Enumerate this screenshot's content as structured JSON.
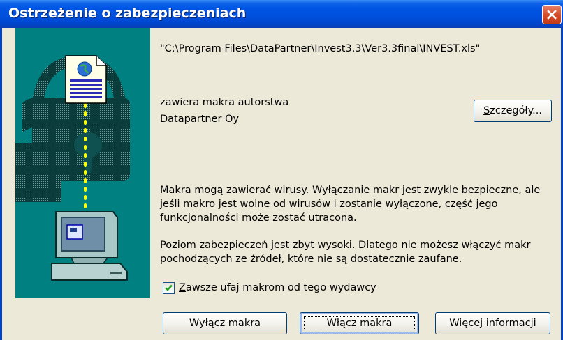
{
  "window": {
    "title": "Ostrzeżenie o zabezpieczeniach"
  },
  "file_path": "\"C:\\Program Files\\DataPartner\\Invest3.3\\Ver3.3final\\INVEST.xls\"",
  "macro_author": {
    "label": "zawiera makra autorstwa",
    "name": "Datapartner Oy"
  },
  "details_button": {
    "hotkey": "S",
    "rest": "zczegóły..."
  },
  "warning_text": "Makra mogą zawierać wirusy. Wyłączanie makr jest zwykle bezpieczne, ale jeśli makro jest wolne od wirusów i zostanie wyłączone, część jego funkcjonalności może zostać utracona.",
  "security_text": "Poziom zabezpieczeń jest zbyt wysoki.  Dlatego nie możesz włączyć makr pochodzących ze źródeł, które nie są dostatecznie zaufane.",
  "trust_checkbox": {
    "checked": true,
    "hotkey": "Z",
    "rest": "awsze ufaj makrom od tego wydawcy"
  },
  "buttons": {
    "disable": {
      "pre": "W",
      "hotkey": "y",
      "post": "łącz makra"
    },
    "enable": {
      "pre": "Włącz ",
      "hotkey": "m",
      "post": "akra"
    },
    "more_info": {
      "pre": "Więcej ",
      "hotkey": "i",
      "post": "nformacji"
    }
  },
  "colors": {
    "titlebar": "#0054E3",
    "panel": "#008080",
    "close_button": "#D34A26",
    "dialog_bg": "#ECE9D8"
  },
  "icons": {
    "close": "close-icon",
    "document": "document-icon",
    "padlock": "padlock-icon",
    "computer": "computer-icon",
    "check": "check-icon"
  }
}
